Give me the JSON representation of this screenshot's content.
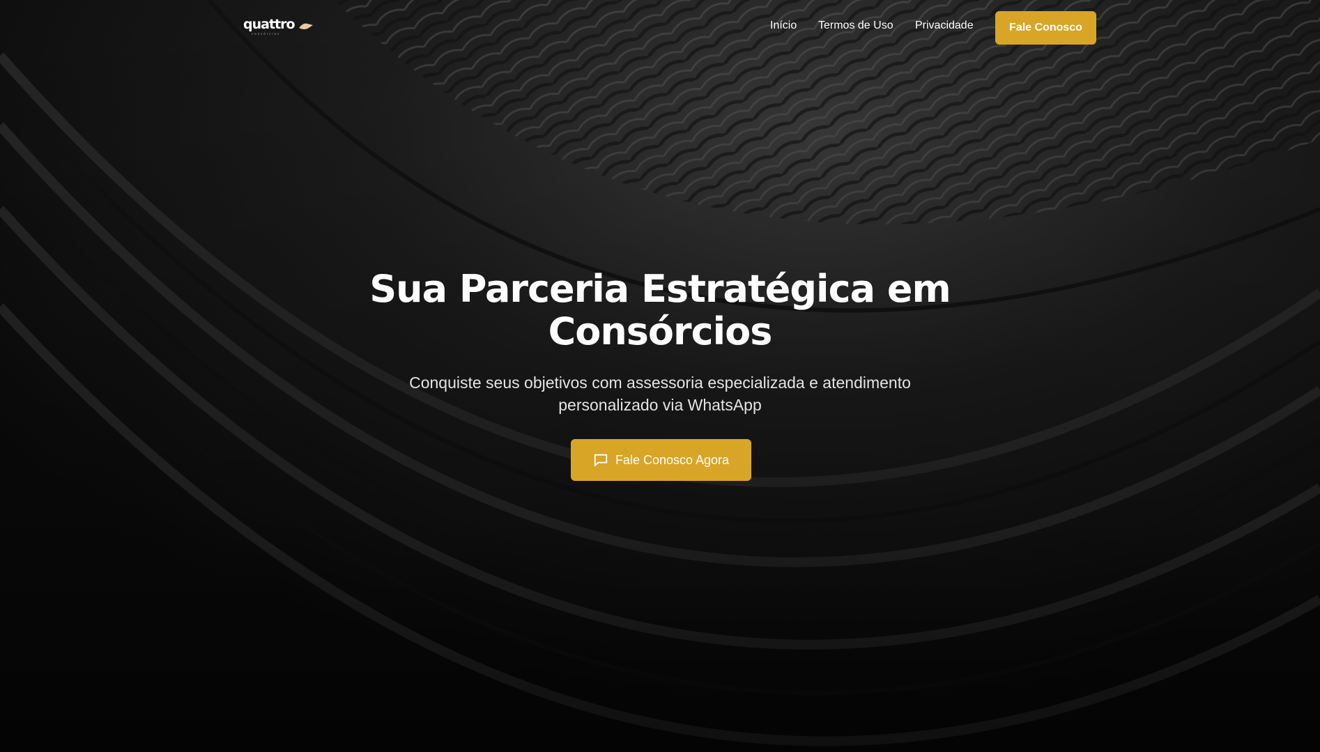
{
  "brand": {
    "name": "quattro",
    "tagline": "consórcios",
    "accent_color": "#d8a526"
  },
  "nav": {
    "links": [
      {
        "label": "Início"
      },
      {
        "label": "Termos de Uso"
      },
      {
        "label": "Privacidade"
      }
    ],
    "cta_label": "Fale Conosco"
  },
  "hero": {
    "title_line1": "Sua Parceria Estratégica em",
    "title_line2": "Consórcios",
    "subtitle_line1": "Conquiste seus objetivos com assessoria especializada e atendimento",
    "subtitle_line2": "personalizado via WhatsApp",
    "cta_label": "Fale Conosco Agora",
    "cta_icon": "chat-bubble-icon"
  }
}
